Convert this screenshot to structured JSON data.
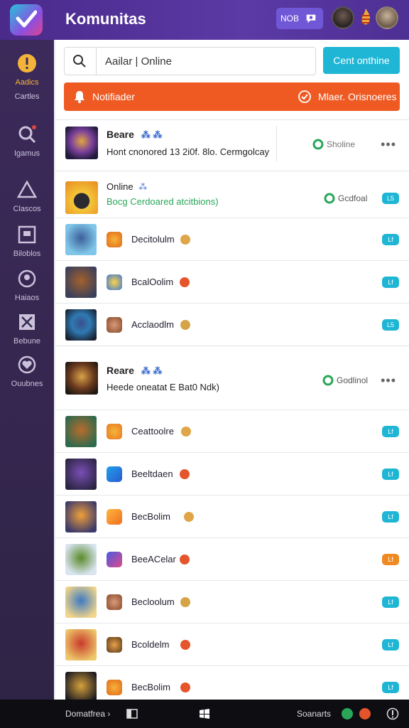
{
  "app": {
    "title": "Komunitas",
    "header_badge": "NOB"
  },
  "colors": {
    "header": "#4e2f93",
    "sidebar": "#35284f",
    "accent": "#1fb6d5",
    "notif": "#ef5a23",
    "active": "#f4b43a"
  },
  "sidebar": {
    "items": [
      {
        "label": "Aadics",
        "icon": "alert-icon",
        "active": true
      },
      {
        "label": "Cartles",
        "icon": "none",
        "active": false
      },
      {
        "label": "Igamus",
        "icon": "search-icon",
        "active": false
      },
      {
        "label": "Clascos",
        "icon": "triangle-icon",
        "active": false
      },
      {
        "label": "Biloblos",
        "icon": "box-icon",
        "active": false
      },
      {
        "label": "Haiaos",
        "icon": "badge-icon",
        "active": false
      },
      {
        "label": "Bebune",
        "icon": "x-box-icon",
        "active": false
      },
      {
        "label": "Ouubnes",
        "icon": "heart-icon",
        "active": false
      }
    ]
  },
  "search": {
    "value": "Aailar | Online"
  },
  "primary_button": "Cent onthine",
  "notification": {
    "label": "Notifiader",
    "right_label": "Mlaer. Orisnoeres"
  },
  "groups": [
    {
      "title": "Beare",
      "subtitle": "Hont cnonored 13 2i0f. 8lo. Cermgolcay",
      "status": "Sholine",
      "more": "•••"
    },
    {
      "title": "Online",
      "subtitle": "Bocg Cerdoared atcitbions)",
      "status": "Gcdfoal",
      "badge": "L5"
    },
    {
      "title": "Reare",
      "subtitle": "Heede oneatat E Bat0 Ndk)",
      "status": "Godlinol",
      "more": "•••"
    }
  ],
  "rows_a": [
    {
      "name": "Decitolulm",
      "pill": "Lf"
    },
    {
      "name": "BcalOolim",
      "pill": "Lf"
    },
    {
      "name": "Acclaodlm",
      "pill": "L5"
    }
  ],
  "rows_b": [
    {
      "name": "Ceattoolre",
      "pill": "Lf"
    },
    {
      "name": "Beeltdaen",
      "pill": "Lf"
    },
    {
      "name": "BecBolim",
      "pill": "Lf"
    },
    {
      "name": "BeeACelar",
      "pill": "Lf",
      "pill_orange": true
    },
    {
      "name": "Becloolum",
      "pill": "Lf"
    },
    {
      "name": "Bcoldelm",
      "pill": "Lf"
    },
    {
      "name": "BecBolim",
      "pill": "Lf"
    }
  ],
  "taskbar": {
    "left": "Domatfrea ›",
    "right": "Soanarts"
  }
}
